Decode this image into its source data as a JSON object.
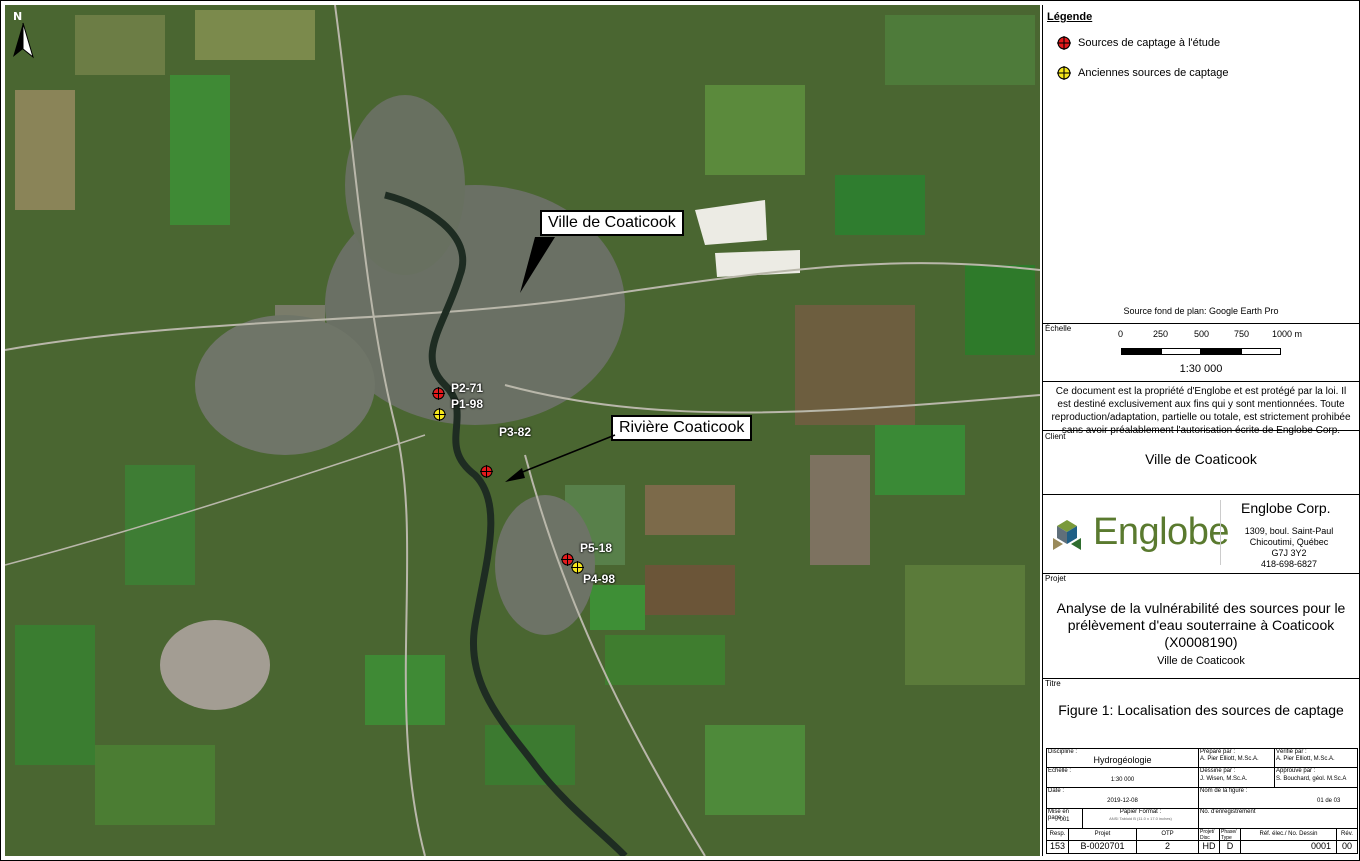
{
  "map": {
    "north_label": "N",
    "callouts": {
      "ville": "Ville de Coaticook",
      "riviere": "Rivière Coaticook"
    },
    "points": [
      {
        "label": "P2-71",
        "type": "etude"
      },
      {
        "label": "P1-98",
        "type": "ancienne"
      },
      {
        "label": "P3-82",
        "type": "etude"
      },
      {
        "label": "P5-18",
        "type": "etude"
      },
      {
        "label": "P4-98",
        "type": "ancienne"
      }
    ],
    "colors": {
      "etude": "#e31a1c",
      "ancienne": "#f5e71c",
      "river": "#1e2c22",
      "field": "#3d7a2e"
    }
  },
  "legend": {
    "title": "Légende",
    "items": [
      "Sources de captage à l'étude",
      "Anciennes sources de captage"
    ],
    "source": "Source fond de plan: Google Earth Pro"
  },
  "scale": {
    "heading": "Échelle",
    "ticks": [
      "0",
      "250",
      "500",
      "750",
      "1000 m"
    ],
    "ratio": "1:30 000"
  },
  "notice": "Ce document est la propriété d'Englobe et est protégé par la loi. Il est destiné exclusivement aux fins qui y sont mentionnées. Toute reproduction/adaptation, partielle ou totale, est strictement prohibée sans avoir préalablement l'autorisation écrite de Englobe Corp.",
  "client": {
    "heading": "Client",
    "name": "Ville de Coaticook"
  },
  "company": {
    "logo": "Englobe",
    "name": "Englobe Corp.",
    "address": [
      "1309, boul. Saint-Paul",
      "Chicoutimi, Québec",
      "G7J 3Y2",
      "418-698-6827"
    ]
  },
  "projet": {
    "heading": "Projet",
    "lines": [
      "Analyse de la vulnérabilité des sources pour le",
      "prélèvement d'eau souterraine à Coaticook",
      "(X0008190)"
    ],
    "sub": "Ville de Coaticook"
  },
  "titre": {
    "heading": "Titre",
    "text": "Figure 1: Localisation des sources de captage"
  },
  "cartouche": {
    "discipline_l": "Discipline :",
    "discipline_v": "Hydrogéologie",
    "prepare_l": "Préparé par :",
    "prepare_v": "A. Pier Elliott, M.Sc.A.",
    "verifie_l": "Vérifié par :",
    "verifie_v": "A. Pier Elliott, M.Sc.A.",
    "echelle_l": "Échelle :",
    "echelle_v": "1:30 000",
    "dessine_l": "Dessiné par :",
    "dessine_v": "J. Wisen, M.Sc.A.",
    "approuve_l": "Approuvé par :",
    "approuve_v": "S. Bouchard, géol. M.Sc.A",
    "date_l": "Date :",
    "date_v": "2019-12-08",
    "nomfig_l": "Nom de la figure :",
    "nomfig_v": "01 de 03",
    "mise_l": "Mise en page :",
    "mise_v": "001",
    "papier_l": "Papier Format :",
    "papier_v": "ANSI Tabloid B (11.0 x 17.0 inches)",
    "enreg_l": "No. d'enregistrement",
    "h_resp": "Resp.",
    "h_projet": "Projet",
    "h_otp": "OTP",
    "h_projdisc": "Projet/ Disc",
    "h_phase": "Phase/ Type",
    "h_ref": "Réf. élec./ No. Dessin",
    "h_rev": "Rév.",
    "v_resp": "153",
    "v_projet": "B-0020701",
    "v_otp": "2",
    "v_disc": "HD",
    "v_type": "D",
    "v_ref": "0001",
    "v_rev": "00"
  }
}
